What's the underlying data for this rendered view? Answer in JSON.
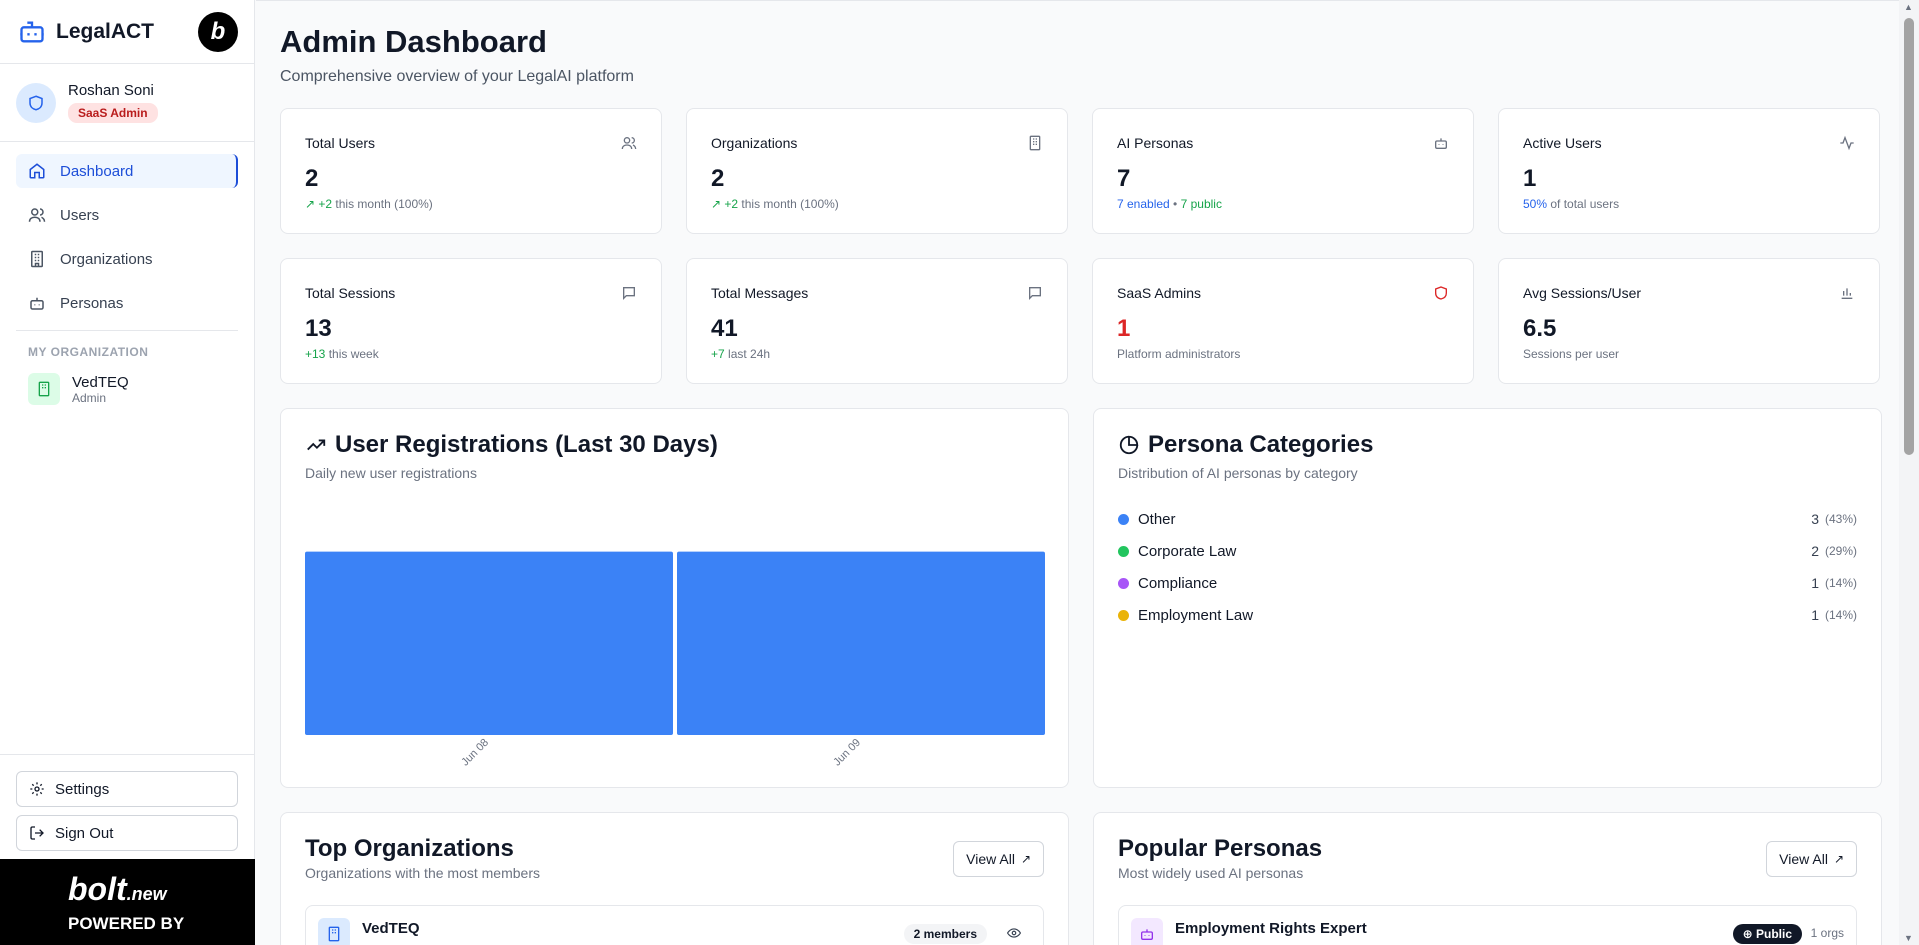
{
  "brand": {
    "name": "LegalACT",
    "badge_letter": "b"
  },
  "user": {
    "name": "Roshan Soni",
    "role": "SaaS Admin"
  },
  "nav": {
    "dashboard": "Dashboard",
    "users": "Users",
    "organizations": "Organizations",
    "personas": "Personas"
  },
  "my_org": {
    "section_label": "MY ORGANIZATION",
    "name": "VedTEQ",
    "role": "Admin"
  },
  "sidebar_bottom": {
    "settings": "Settings",
    "sign_out": "Sign Out"
  },
  "powered": {
    "brand": "bolt",
    "brand_suffix": ".new",
    "text": "POWERED BY"
  },
  "page": {
    "title": "Admin Dashboard",
    "subtitle": "Comprehensive overview of your LegalAI platform"
  },
  "stats": {
    "total_users": {
      "label": "Total Users",
      "value": "2",
      "delta": "↗ +2",
      "delta_rest": " this month (100%)"
    },
    "organizations": {
      "label": "Organizations",
      "value": "2",
      "delta": "↗ +2",
      "delta_rest": " this month (100%)"
    },
    "ai_personas": {
      "label": "AI Personas",
      "value": "7",
      "enabled": "7 enabled",
      "sep": " • ",
      "public": "7 public"
    },
    "active_users": {
      "label": "Active Users",
      "value": "1",
      "pct": "50%",
      "rest": " of total users"
    },
    "total_sessions": {
      "label": "Total Sessions",
      "value": "13",
      "delta": "+13",
      "rest": " this week"
    },
    "total_messages": {
      "label": "Total Messages",
      "value": "41",
      "delta": "+7",
      "rest": " last 24h"
    },
    "saas_admins": {
      "label": "SaaS Admins",
      "value": "1",
      "sub": "Platform administrators"
    },
    "avg_sessions": {
      "label": "Avg Sessions/User",
      "value": "6.5",
      "sub": "Sessions per user"
    }
  },
  "registrations": {
    "title": "User Registrations (Last 30 Days)",
    "subtitle": "Daily new user registrations"
  },
  "chart_data": {
    "type": "bar",
    "categories": [
      "Jun 08",
      "Jun 09"
    ],
    "values": [
      1,
      1
    ],
    "ylim": [
      0,
      1.2
    ],
    "color": "#3b82f6",
    "grid": false
  },
  "persona_categories": {
    "title": "Persona Categories",
    "subtitle": "Distribution of AI personas by category",
    "items": [
      {
        "name": "Other",
        "count": "3",
        "pct": "(43%)",
        "color": "#3b82f6"
      },
      {
        "name": "Corporate Law",
        "count": "2",
        "pct": "(29%)",
        "color": "#22c55e"
      },
      {
        "name": "Compliance",
        "count": "1",
        "pct": "(14%)",
        "color": "#a855f7"
      },
      {
        "name": "Employment Law",
        "count": "1",
        "pct": "(14%)",
        "color": "#eab308"
      }
    ]
  },
  "top_orgs": {
    "title": "Top Organizations",
    "subtitle": "Organizations with the most members",
    "view_all": "View All",
    "first": {
      "name": "VedTEQ",
      "members": "2 members"
    }
  },
  "popular_personas": {
    "title": "Popular Personas",
    "subtitle": "Most widely used AI personas",
    "view_all": "View All",
    "first": {
      "name": "Employment Rights Expert",
      "visibility": "⊕ Public",
      "orgs": "1 orgs"
    }
  }
}
